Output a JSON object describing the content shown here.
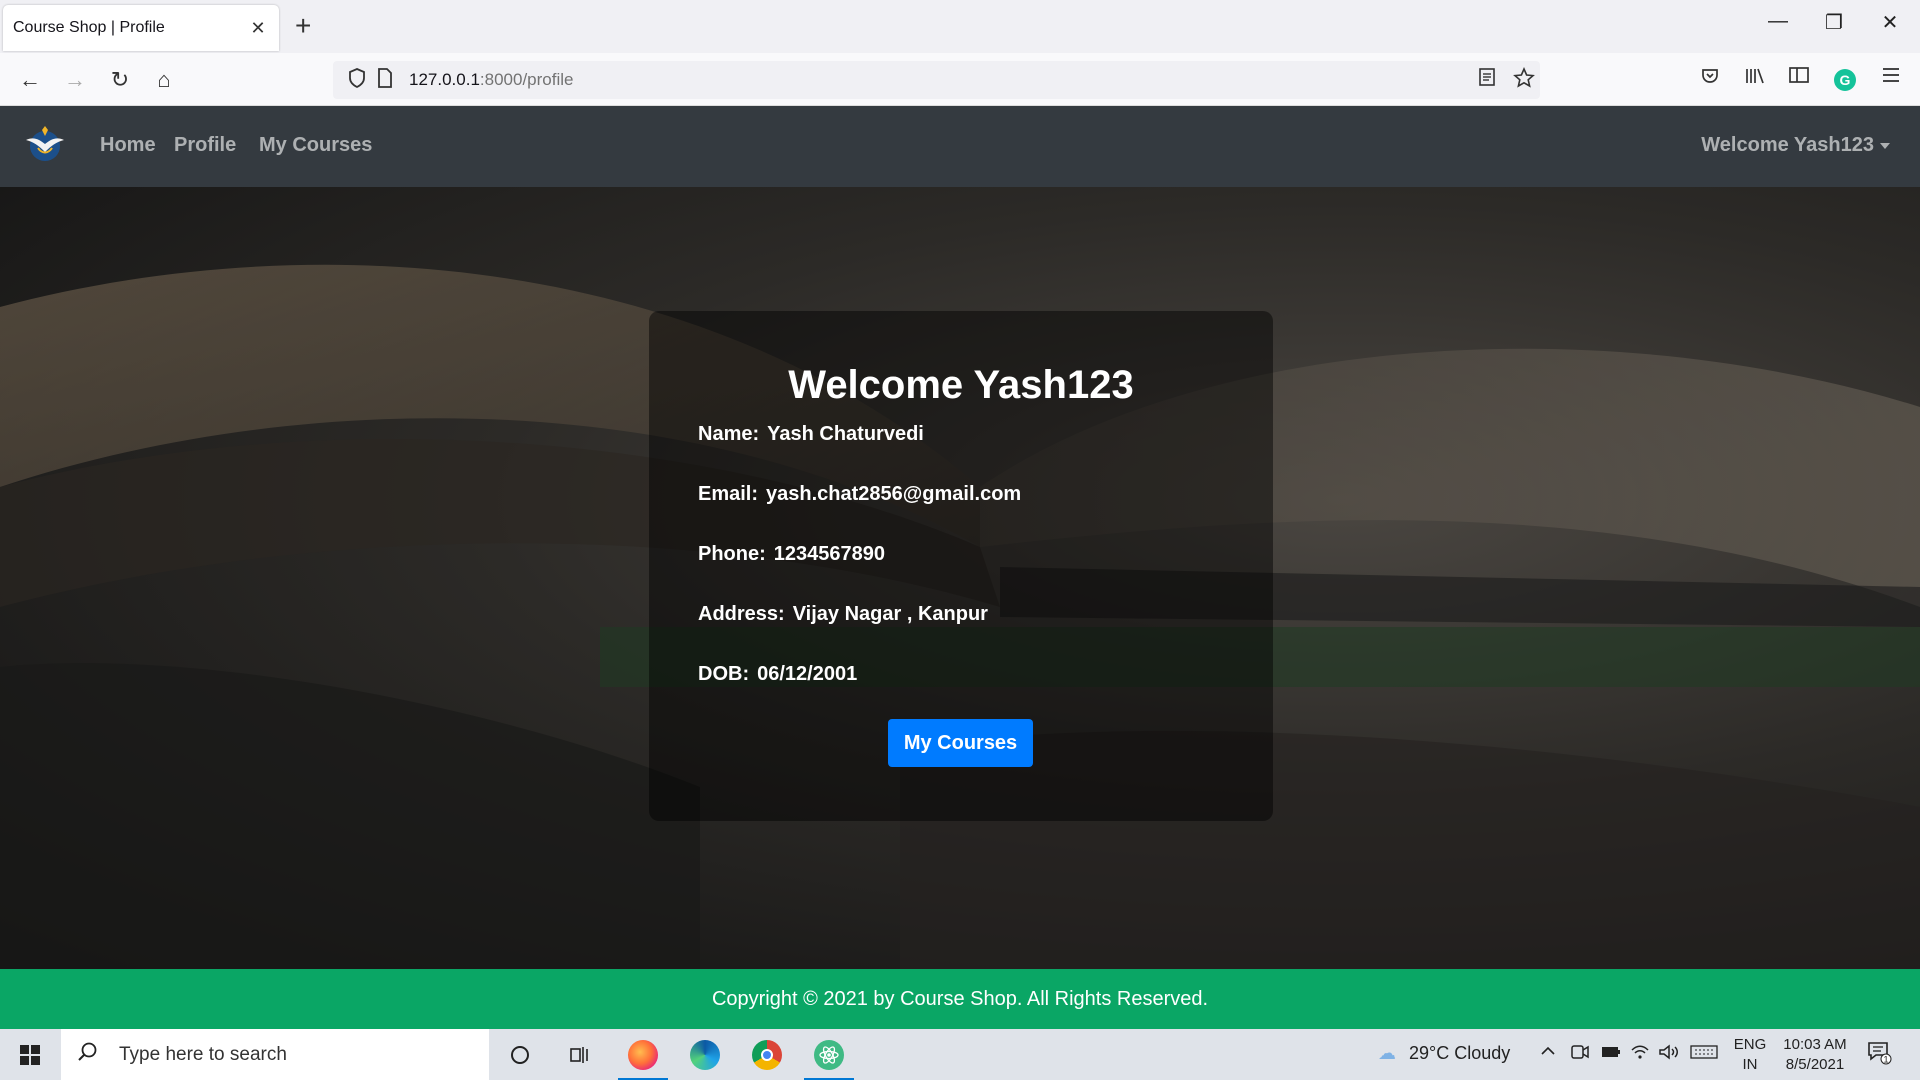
{
  "browser": {
    "tab_title": "Course Shop | Profile",
    "tab_close": "✕",
    "new_tab": "+",
    "url_host": "127.0.0.1",
    "url_path": ":8000/profile",
    "window_controls": {
      "minimize": "—",
      "restore": "❐",
      "close": "✕"
    },
    "nav_icons": {
      "back": "←",
      "forward": "→",
      "reload": "↻",
      "home": "⌂"
    }
  },
  "site": {
    "nav": {
      "links": [
        "Home",
        "Profile",
        "My Courses"
      ],
      "user_menu": "Welcome Yash123"
    },
    "profile": {
      "title": "Welcome Yash123",
      "fields": [
        {
          "label": "Name:",
          "value": "Yash Chaturvedi"
        },
        {
          "label": "Email:",
          "value": "yash.chat2856@gmail.com"
        },
        {
          "label": "Phone:",
          "value": "1234567890"
        },
        {
          "label": "Address:",
          "value": "Vijay Nagar , Kanpur"
        },
        {
          "label": "DOB:",
          "value": "06/12/2001"
        }
      ],
      "button_label": "My Courses"
    },
    "footer_text": "Copyright © 2021 by Course Shop. All Rights Reserved."
  },
  "taskbar": {
    "search_placeholder": "Type here to search",
    "weather": "29°C  Cloudy",
    "lang_line1": "ENG",
    "lang_line2": "IN",
    "time": "10:03 AM",
    "date": "8/5/2021",
    "notification_count": "1"
  },
  "colors": {
    "navbar": "#343a40",
    "button": "#007bff",
    "footer": "#0aa665"
  }
}
